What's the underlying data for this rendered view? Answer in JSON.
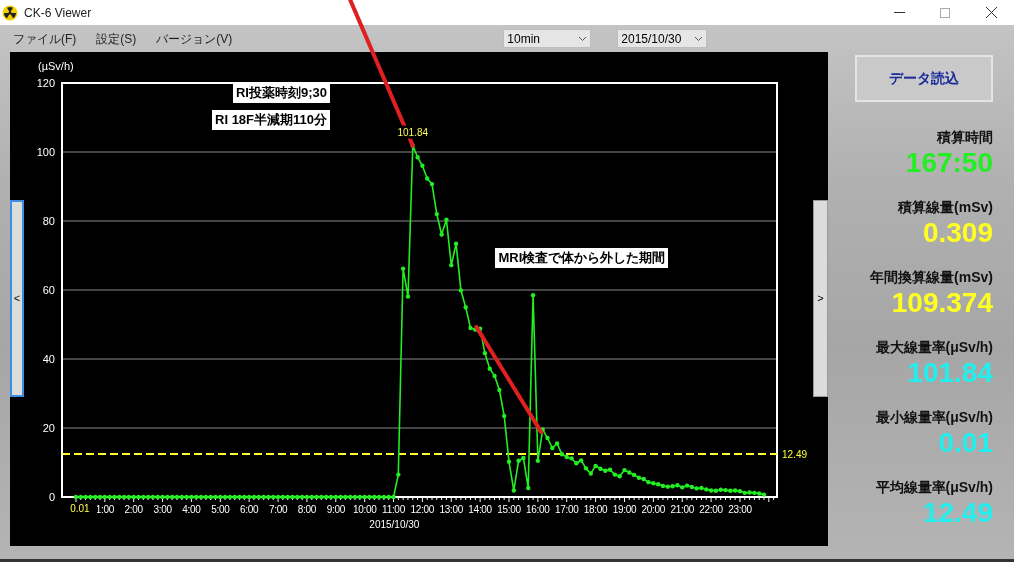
{
  "window": {
    "title": "CK-6 Viewer"
  },
  "menu": [
    "ファイル(F)",
    "設定(S)",
    "バージョン(V)"
  ],
  "interval_select": {
    "value": "10min"
  },
  "date_select": {
    "value": "2015/10/30"
  },
  "scroll_left": "<",
  "scroll_right": ">",
  "chart": {
    "chart_data": {
      "type": "line",
      "ylabel": "(µSv/h)",
      "xlabel": "2015/10/30",
      "xlim": [
        -29,
        1457
      ],
      "ylim": [
        0,
        120
      ],
      "yticks": [
        0,
        20,
        40,
        60,
        80,
        100,
        120
      ],
      "xticks": [
        {
          "value": 60,
          "label": "1:00"
        },
        {
          "value": 120,
          "label": "2:00"
        },
        {
          "value": 180,
          "label": "3:00"
        },
        {
          "value": 240,
          "label": "4:00"
        },
        {
          "value": 300,
          "label": "5:00"
        },
        {
          "value": 360,
          "label": "6:00"
        },
        {
          "value": 420,
          "label": "7:00"
        },
        {
          "value": 480,
          "label": "8:00"
        },
        {
          "value": 540,
          "label": "9:00"
        },
        {
          "value": 600,
          "label": "10:00"
        },
        {
          "value": 660,
          "label": "11:00"
        },
        {
          "value": 720,
          "label": "12:00"
        },
        {
          "value": 780,
          "label": "13:00"
        },
        {
          "value": 840,
          "label": "14:00"
        },
        {
          "value": 900,
          "label": "15:00"
        },
        {
          "value": 960,
          "label": "16:00"
        },
        {
          "value": 1020,
          "label": "17:00"
        },
        {
          "value": 1080,
          "label": "18:00"
        },
        {
          "value": 1140,
          "label": "19:00"
        },
        {
          "value": 1200,
          "label": "20:00"
        },
        {
          "value": 1260,
          "label": "21:00"
        },
        {
          "value": 1320,
          "label": "22:00"
        },
        {
          "value": 1380,
          "label": "23:00"
        }
      ],
      "x": [
        0,
        10,
        20,
        30,
        40,
        50,
        60,
        70,
        80,
        90,
        100,
        110,
        120,
        130,
        140,
        150,
        160,
        170,
        180,
        190,
        200,
        210,
        220,
        230,
        240,
        250,
        260,
        270,
        280,
        290,
        300,
        310,
        320,
        330,
        340,
        350,
        360,
        370,
        380,
        390,
        400,
        410,
        420,
        430,
        440,
        450,
        460,
        470,
        480,
        490,
        500,
        510,
        520,
        530,
        540,
        550,
        560,
        570,
        580,
        590,
        600,
        610,
        620,
        630,
        640,
        650,
        660,
        670,
        680,
        690,
        700,
        710,
        720,
        730,
        740,
        750,
        760,
        770,
        780,
        790,
        800,
        810,
        820,
        830,
        840,
        850,
        860,
        870,
        880,
        890,
        900,
        910,
        920,
        930,
        940,
        950,
        960,
        970,
        980,
        990,
        1000,
        1010,
        1020,
        1030,
        1040,
        1050,
        1060,
        1070,
        1080,
        1090,
        1100,
        1110,
        1120,
        1130,
        1140,
        1150,
        1160,
        1170,
        1180,
        1190,
        1200,
        1210,
        1220,
        1230,
        1240,
        1250,
        1260,
        1270,
        1280,
        1290,
        1300,
        1310,
        1320,
        1330,
        1340,
        1350,
        1360,
        1370,
        1380,
        1390,
        1400,
        1410,
        1420,
        1430
      ],
      "grid": true,
      "series": [
        {
          "color": "#22ee22",
          "values": [
            0.01,
            0.01,
            0.01,
            0.01,
            0.01,
            0.01,
            0.01,
            0.01,
            0.01,
            0.01,
            0.01,
            0.01,
            0.01,
            0.01,
            0.01,
            0.01,
            0.01,
            0.01,
            0.01,
            0.01,
            0.01,
            0.01,
            0.01,
            0.01,
            0.01,
            0.01,
            0.01,
            0.01,
            0.01,
            0.01,
            0.01,
            0.01,
            0.01,
            0.01,
            0.01,
            0.01,
            0.01,
            0.01,
            0.01,
            0.01,
            0.01,
            0.01,
            0.01,
            0.01,
            0.01,
            0.01,
            0.01,
            0.01,
            0.01,
            0.01,
            0.01,
            0.01,
            0.01,
            0.01,
            0.01,
            0.01,
            0.01,
            0.01,
            0.01,
            0.01,
            0.01,
            0.01,
            0.01,
            0.01,
            0.01,
            0.01,
            0.01,
            6.5,
            66.2,
            58.1,
            101.84,
            98.5,
            96.0,
            92.3,
            90.7,
            82.0,
            76.1,
            80.4,
            67.2,
            73.4,
            59.9,
            55.0,
            49.0,
            48.5,
            48.8,
            41.7,
            37.2,
            35.1,
            31.0,
            23.5,
            10.2,
            1.9,
            10.5,
            11.3,
            2.6,
            58.5,
            10.5,
            19.6,
            17.1,
            14.2,
            15.5,
            12.4,
            11.6,
            11.2,
            9.8,
            10.6,
            8.3,
            6.8,
            9.0,
            8.2,
            7.6,
            7.9,
            6.5,
            6.0,
            7.8,
            7.1,
            6.4,
            5.6,
            5.2,
            4.3,
            4.0,
            3.7,
            3.2,
            3.0,
            3.1,
            3.4,
            2.8,
            3.3,
            2.9,
            2.5,
            2.6,
            2.2,
            1.9,
            1.8,
            2.1,
            2.0,
            1.8,
            1.9,
            1.7,
            1.2,
            1.3,
            1.2,
            1.0,
            0.7
          ]
        }
      ],
      "annotations": [
        {
          "text": "101.84",
          "x": 700,
          "y": 101.84
        },
        {
          "text": "0.01",
          "x": 0,
          "y": 0.01
        }
      ],
      "ref_lines": [
        {
          "axis": "y",
          "value": 12.49,
          "label": "12.49",
          "color": "#ffff33"
        }
      ]
    },
    "notes": [
      {
        "text": "RI投薬時刻9;30"
      },
      {
        "text": "RI 18F半減期110分"
      },
      {
        "text": "MRI検査で体から外した期間"
      }
    ]
  },
  "load_button": "データ読込",
  "stats": [
    {
      "label": "積算時間",
      "value": "167:50",
      "color": "#22ee22"
    },
    {
      "label": "積算線量(mSv)",
      "value": "0.309",
      "color": "#ffff22"
    },
    {
      "label": "年間換算線量(mSv)",
      "value": "109.374",
      "color": "#ffff22"
    },
    {
      "label": "最大線量率(μSv/h)",
      "value": "101.84",
      "color": "#22eeee"
    },
    {
      "label": "最小線量率(μSv/h)",
      "value": "0.01",
      "color": "#22eeee"
    },
    {
      "label": "平均線量率(μSv/h)",
      "value": "12.49",
      "color": "#22eeee"
    }
  ]
}
